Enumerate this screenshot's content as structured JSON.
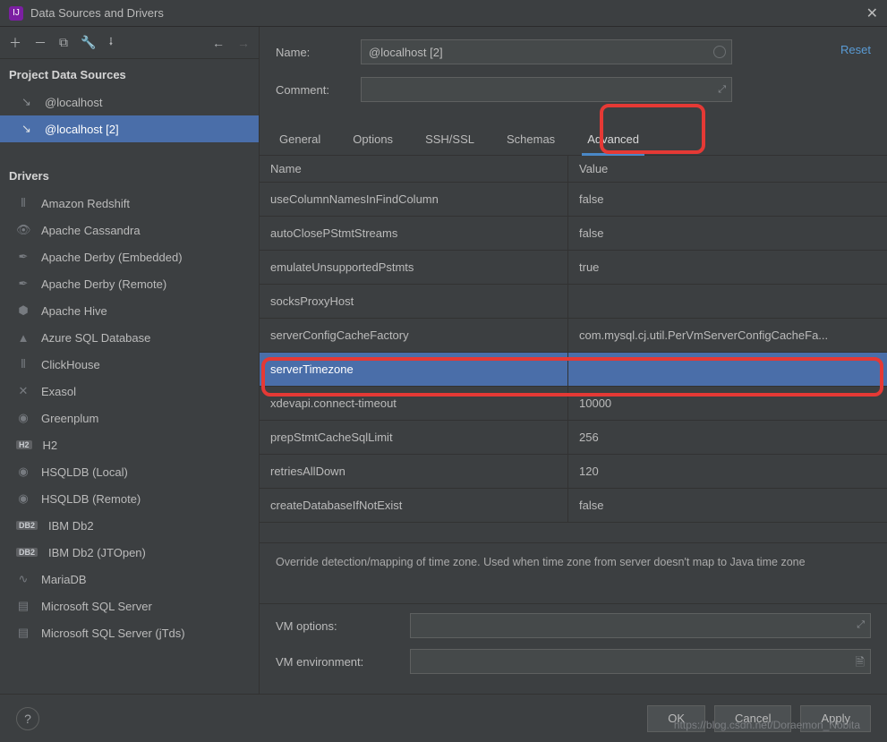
{
  "window": {
    "title": "Data Sources and Drivers"
  },
  "sidebar": {
    "projectTitle": "Project Data Sources",
    "projectItems": [
      {
        "label": "@localhost"
      },
      {
        "label": "@localhost [2]"
      }
    ],
    "driversTitle": "Drivers",
    "drivers": [
      {
        "label": "Amazon Redshift",
        "icon": "⦀"
      },
      {
        "label": "Apache Cassandra",
        "icon": "👁"
      },
      {
        "label": "Apache Derby (Embedded)",
        "icon": "✒"
      },
      {
        "label": "Apache Derby (Remote)",
        "icon": "✒"
      },
      {
        "label": "Apache Hive",
        "icon": "⬢"
      },
      {
        "label": "Azure SQL Database",
        "icon": "▲"
      },
      {
        "label": "ClickHouse",
        "icon": "⦀"
      },
      {
        "label": "Exasol",
        "icon": "✕"
      },
      {
        "label": "Greenplum",
        "icon": "◉"
      },
      {
        "label": "H2",
        "icon": "H2"
      },
      {
        "label": "HSQLDB (Local)",
        "icon": "◉"
      },
      {
        "label": "HSQLDB (Remote)",
        "icon": "◉"
      },
      {
        "label": "IBM Db2",
        "icon": "DB2"
      },
      {
        "label": "IBM Db2 (JTOpen)",
        "icon": "DB2"
      },
      {
        "label": "MariaDB",
        "icon": "∿"
      },
      {
        "label": "Microsoft SQL Server",
        "icon": "▤"
      },
      {
        "label": "Microsoft SQL Server (jTds)",
        "icon": "▤"
      }
    ]
  },
  "form": {
    "nameLabel": "Name:",
    "nameValue": "@localhost [2]",
    "commentLabel": "Comment:",
    "reset": "Reset"
  },
  "tabs": [
    "General",
    "Options",
    "SSH/SSL",
    "Schemas",
    "Advanced"
  ],
  "table": {
    "headName": "Name",
    "headValue": "Value",
    "rows": [
      {
        "name": "useColumnNamesInFindColumn",
        "value": "false"
      },
      {
        "name": "autoClosePStmtStreams",
        "value": "false"
      },
      {
        "name": "emulateUnsupportedPstmts",
        "value": "true"
      },
      {
        "name": "socksProxyHost",
        "value": ""
      },
      {
        "name": "serverConfigCacheFactory",
        "value": "com.mysql.cj.util.PerVmServerConfigCacheFa..."
      },
      {
        "name": "serverTimezone",
        "value": ""
      },
      {
        "name": "xdevapi.connect-timeout",
        "value": "10000"
      },
      {
        "name": "prepStmtCacheSqlLimit",
        "value": "256"
      },
      {
        "name": "retriesAllDown",
        "value": "120"
      },
      {
        "name": "createDatabaseIfNotExist",
        "value": "false"
      }
    ],
    "selectedIndex": 5
  },
  "description": "Override detection/mapping of time zone. Used when time zone from server doesn't map to Java time zone",
  "vm": {
    "optionsLabel": "VM options:",
    "envLabel": "VM environment:"
  },
  "footer": {
    "ok": "OK",
    "cancel": "Cancel",
    "apply": "Apply"
  },
  "watermark": "https://blog.csdn.net/Doraemon_Nobita"
}
